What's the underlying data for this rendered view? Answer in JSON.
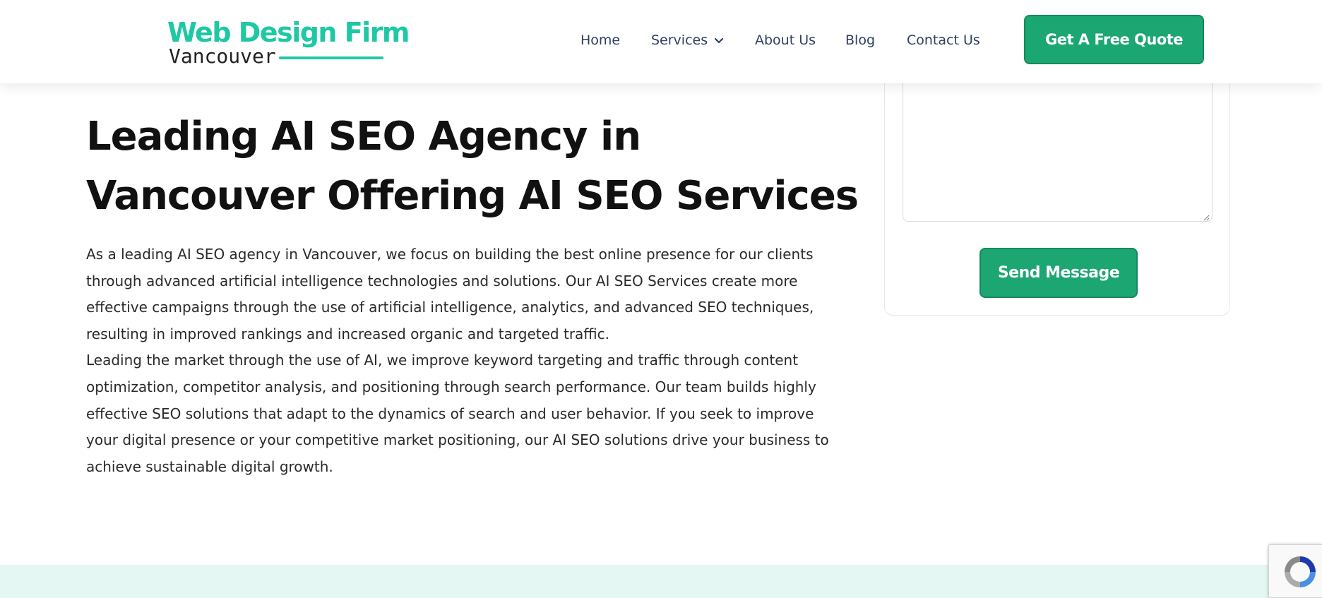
{
  "header": {
    "logo": {
      "line1": "Web Design Firm",
      "line2": "Vancouver"
    },
    "nav": [
      {
        "label": "Home"
      },
      {
        "label": "Services"
      },
      {
        "label": "About Us"
      },
      {
        "label": "Blog"
      },
      {
        "label": "Contact Us"
      }
    ],
    "cta_label": "Get A Free Quote"
  },
  "hero": {
    "title": "Leading AI SEO Agency in Vancouver Offering AI SEO Services",
    "paragraphs": [
      "As a leading AI SEO agency in Vancouver, we focus on building the best online presence for our clients through advanced artificial intelligence technologies and solutions. Our AI SEO Services create more effective campaigns through the use of artificial intelligence, analytics, and advanced SEO techniques, resulting in improved rankings and increased organic and targeted traffic.",
      "Leading the market through the use of AI, we improve keyword targeting and traffic through content optimization, competitor analysis, and positioning through search performance. Our team builds highly effective SEO solutions that adapt to the dynamics of search and user behavior. If you seek to improve your digital presence or your competitive market positioning, our AI SEO solutions drive your business to achieve sustainable digital growth."
    ]
  },
  "form": {
    "message_value": "",
    "send_label": "Send Message"
  },
  "colors": {
    "brand_green": "#1ba672",
    "logo_teal": "#1ec8a5",
    "nav_text": "#2f3f5f",
    "band": "#e4f7f2"
  },
  "icons": {
    "services_dropdown": "chevron-down-icon",
    "recaptcha": "recaptcha-logo-icon",
    "textarea_resize": "resize-grip-icon"
  }
}
